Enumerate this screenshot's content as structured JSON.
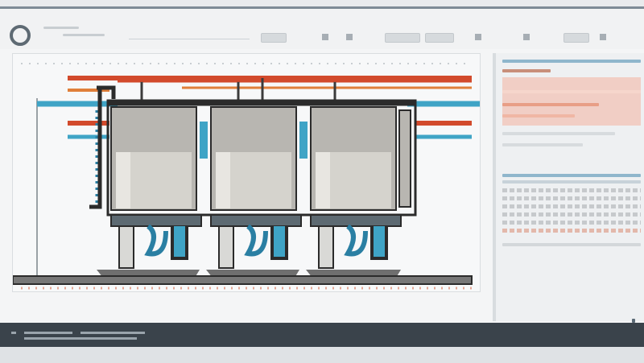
{
  "app": {
    "logo_icon": "app-logo-icon"
  },
  "toolbar": {
    "buttons": [
      "toolbar-button",
      "toolbar-button",
      "toolbar-button",
      "toolbar-button"
    ],
    "icons": [
      "grid-icon",
      "layers-icon",
      "zoom-icon",
      "settings-icon"
    ]
  },
  "drawing": {
    "description_icon": "pump-system-schematic",
    "units": 3,
    "pipe_colors": {
      "hot": "#d24a2c",
      "cold": "#3fa4c6",
      "dark": "#3b3b3b"
    },
    "tank_color": "#b8b6b1",
    "base_color": "#6f6f6f",
    "accent": "#2a7fa3"
  },
  "panel": {
    "header_color": "#8fb6cc",
    "highlight_color": "#f2c3b6"
  },
  "colors": {
    "bottombar": "#3a434b",
    "window_border": "#7e8b96"
  }
}
